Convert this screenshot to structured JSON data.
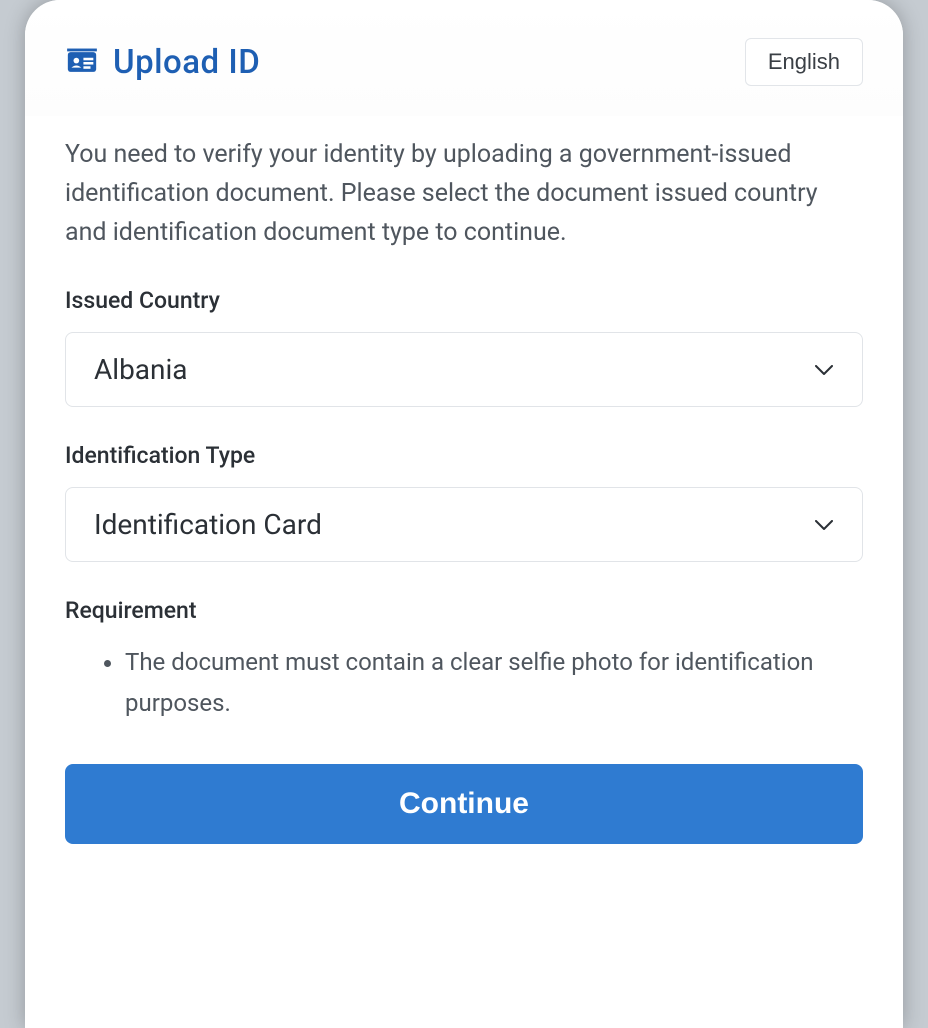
{
  "header": {
    "title": "Upload ID",
    "language_button": "English"
  },
  "intro_text": "You need to verify your identity by uploading a government-issued identification document. Please select the document issued country and identification document type to continue.",
  "fields": {
    "country": {
      "label": "Issued Country",
      "value": "Albania"
    },
    "id_type": {
      "label": "Identification Type",
      "value": "Identification Card"
    }
  },
  "requirement": {
    "label": "Requirement",
    "items": [
      "The document must contain a clear selfie photo for identification purposes."
    ]
  },
  "continue_button": "Continue"
}
